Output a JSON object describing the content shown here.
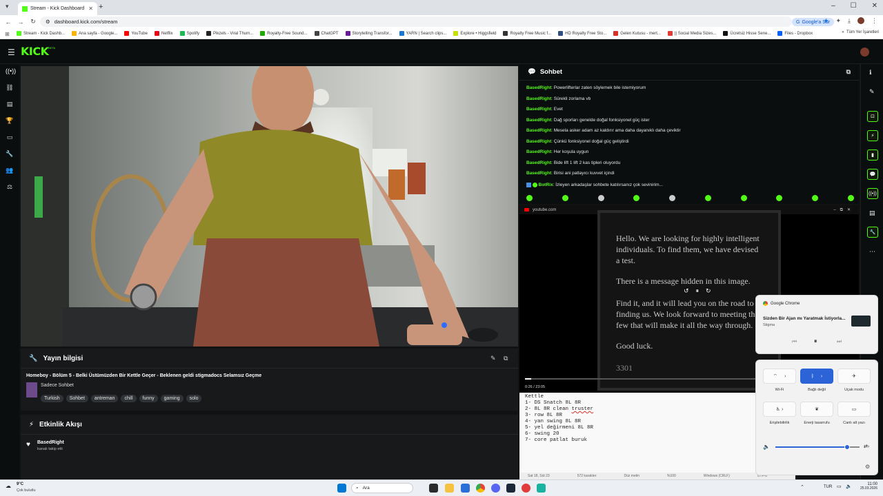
{
  "browser": {
    "tab_title": "Stream - Kick Dashboard",
    "url": "dashboard.kick.com/stream",
    "ask_google": "Google'a Sor",
    "bookmarks": [
      {
        "label": "Stream - Kick Dashb...",
        "color": "#53fc18"
      },
      {
        "label": "Ana sayfa - Google...",
        "color": "#ffb300"
      },
      {
        "label": "YouTube",
        "color": "#ff0000"
      },
      {
        "label": "Netflix",
        "color": "#e50914"
      },
      {
        "label": "Spotify",
        "color": "#1db954"
      },
      {
        "label": "Pikzels - Viral Thum...",
        "color": "#222"
      },
      {
        "label": "Royalty-Free Sound...",
        "color": "#1faa00"
      },
      {
        "label": "ChatGPT",
        "color": "#444"
      },
      {
        "label": "Storytelling Transfor...",
        "color": "#6a1b9a"
      },
      {
        "label": "YARN | Search clips...",
        "color": "#1976d2"
      },
      {
        "label": "Explore • Higgsfield",
        "color": "#c6e000"
      },
      {
        "label": "Royalty Free Music f...",
        "color": "#333"
      },
      {
        "label": "HD Royalty Free Sto...",
        "color": "#2f4f7f"
      },
      {
        "label": "Gelen Kutusu - mert...",
        "color": "#d93025"
      },
      {
        "label": "|| Social Media Sizes...",
        "color": "#e53935"
      },
      {
        "label": "Ücretsiz Hisse Sene...",
        "color": "#111"
      },
      {
        "label": "Files - Dropbox",
        "color": "#0061ff"
      }
    ],
    "all_bookmarks": "Tüm Yer İşaretleri"
  },
  "kick": {
    "logo": "KICK",
    "beta": "BETA"
  },
  "stream_info": {
    "heading": "Yayın bilgisi",
    "title": "Homeboy - Bölüm 5 - Belki Üstümüzden Bir Kettle Geçer - Beklenen geldi stigmadocs Selamsız Geçme",
    "category": "Sadece Sohbet",
    "tags": [
      "Turkish",
      "Sohbet",
      "antreman",
      "chill",
      "funny",
      "gaming",
      "solo"
    ]
  },
  "activity": {
    "heading": "Etkinlik Akışı",
    "user": "BasedRight",
    "event": "kanalı takip etti"
  },
  "chat": {
    "heading": "Sohbet",
    "messages": [
      {
        "user": "BasedRight",
        "text": "Powerlifterlar zaten söylemek bile istemiyorum"
      },
      {
        "user": "BasedRight",
        "text": "Sürekli zorlama vb"
      },
      {
        "user": "BasedRight",
        "text": "Evet"
      },
      {
        "user": "BasedRight",
        "text": "Dağ sporları genelde doğal fonksiyonel güç ister"
      },
      {
        "user": "BasedRight",
        "text": "Mesela asker adam az kaldırır ama daha dayanıklı daha çeviktir"
      },
      {
        "user": "BasedRight",
        "text": "Çünkü fonksiyonel doğal güç geliştirdi"
      },
      {
        "user": "BasedRight",
        "text": "Her koşula uygun"
      },
      {
        "user": "BasedRight",
        "text": "Bide lift 1 lift 2 kas tipleri oluyordu"
      },
      {
        "user": "BasedRight",
        "text": "Birisi ani patlayıcı kuvvet içindi"
      }
    ],
    "bot_user": "BotRix",
    "bot_text": "İzleyen arkadaşlar sohbete katılırsanız çok sevinirim..."
  },
  "youtube": {
    "source": "youtube.com",
    "lines": [
      "Hello.  We are looking for highly intelligent",
      "individuals.  To find them, we have devised",
      "a test.",
      "There is a message hidden in this image.",
      "Find it, and it will lead you on the road to",
      "finding us.  We look forward to meeting the",
      "few that will make it all the way through.",
      "Good luck.",
      "3301"
    ],
    "time": "0:26 / 23:05",
    "progress": 0.019
  },
  "notepad": {
    "lines": [
      "Kettle",
      "1- DS Snatch 8L 8R",
      "2- 8L 8R clean ",
      "3- row 8L 8R",
      "4- yan swing 8L 8R",
      "5- yel değirmeni 8L 8R",
      "6- swing 20",
      "7- core patlat buruk"
    ],
    "underlined": "truster",
    "status": [
      "Sat 18, Süt 23",
      "572 karakter",
      "Düz metin",
      "%100",
      "Windows (CRLF)",
      "UTF-8"
    ]
  },
  "media_flyout": {
    "app": "Google Chrome",
    "title": "Sizden Bir Ajan mı Yaratmak İstiyorla...",
    "artist": "Stigma"
  },
  "quick_settings": {
    "wifi": "Wi-Fi",
    "bluetooth": "Bağlı değil",
    "airplane": "Uçak modu",
    "accessibility": "Erişilebilirlik",
    "energy": "Enerji tasarrufu",
    "captions": "Canlı alt yazı",
    "volume": 0.85
  },
  "taskbar": {
    "weather_temp": "9°C",
    "weather_text": "Çok bulutlu",
    "search": "Ara",
    "lang": "TUR",
    "time": "11:00",
    "date": "25.03.2026"
  }
}
